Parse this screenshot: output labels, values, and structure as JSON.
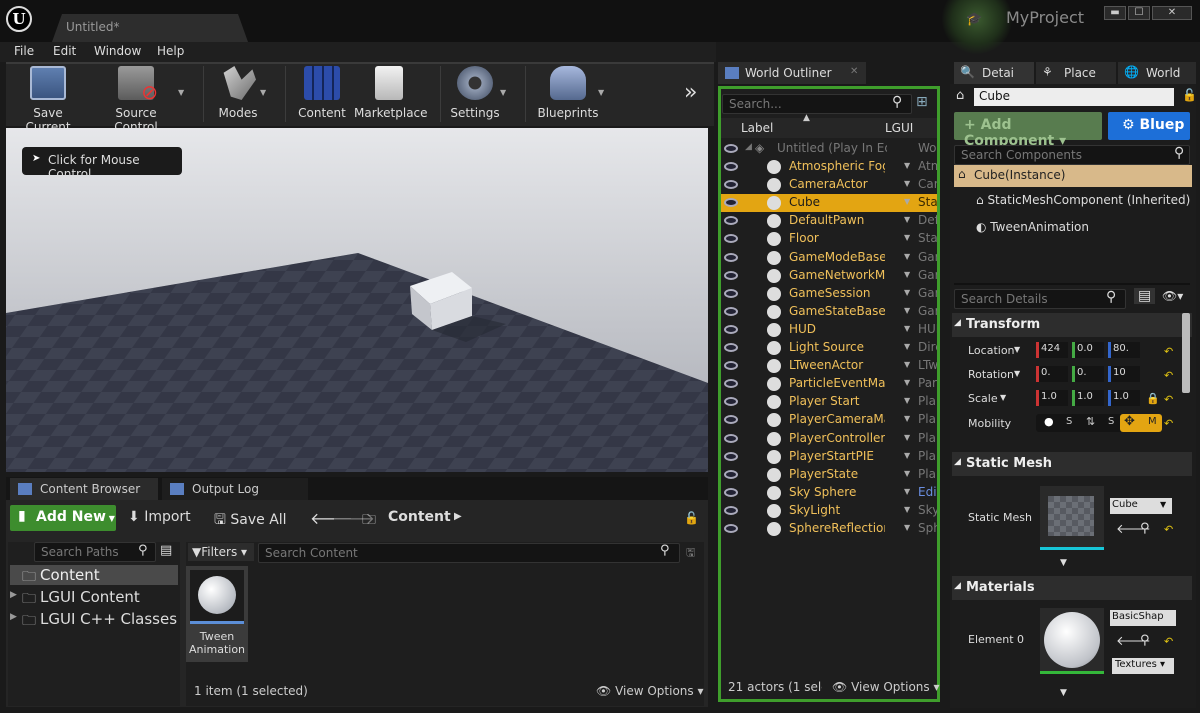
{
  "titlebar": {
    "doc_tab": "Untitled*",
    "project": "MyProject",
    "minimize": "▬",
    "restore": "☐",
    "close": "✕"
  },
  "menu": [
    "File",
    "Edit",
    "Window",
    "Help"
  ],
  "toolbar": {
    "save": "Save Current",
    "source": "Source Control",
    "modes": "Modes",
    "content": "Content",
    "marketplace": "Marketplace",
    "settings": "Settings",
    "blueprints": "Blueprints",
    "more": "»"
  },
  "viewport": {
    "hint": "Click for Mouse Control"
  },
  "content_browser": {
    "tab": "Content Browser",
    "tab2": "Output Log",
    "add_new": "Add New",
    "import": "Import",
    "save_all": "Save All",
    "path": "Content",
    "search_paths": "Search Paths",
    "filters": "Filters",
    "search_content": "Search Content",
    "tree": [
      "Content",
      "LGUI Content",
      "LGUI C++ Classes"
    ],
    "asset": {
      "line1": "Tween",
      "line2": "Animation"
    },
    "status": "1 item (1 selected)",
    "view_options": "View Options"
  },
  "outliner": {
    "tab": "World Outliner",
    "search": "Search...",
    "col_label": "Label",
    "col_lgui": "LGUI",
    "root": {
      "name": "Untitled (Play In Ed",
      "type": "Wor"
    },
    "rows": [
      {
        "name": "Atmospheric Fog",
        "type": "Atm"
      },
      {
        "name": "CameraActor",
        "type": "Car"
      },
      {
        "name": "Cube",
        "type": "Sta"
      },
      {
        "name": "DefaultPawn",
        "type": "Def"
      },
      {
        "name": "Floor",
        "type": "Sta"
      },
      {
        "name": "GameModeBase",
        "type": "Gar"
      },
      {
        "name": "GameNetworkMa",
        "type": "Gar"
      },
      {
        "name": "GameSession",
        "type": "Gar"
      },
      {
        "name": "GameStateBase",
        "type": "Gar"
      },
      {
        "name": "HUD",
        "type": "HUI"
      },
      {
        "name": "Light Source",
        "type": "Dire"
      },
      {
        "name": "LTweenActor",
        "type": "LTw"
      },
      {
        "name": "ParticleEventMa",
        "type": "Par"
      },
      {
        "name": "Player Start",
        "type": "Pla"
      },
      {
        "name": "PlayerCameraMa",
        "type": "Pla"
      },
      {
        "name": "PlayerController",
        "type": "Pla"
      },
      {
        "name": "PlayerStartPIE",
        "type": "Pla"
      },
      {
        "name": "PlayerState",
        "type": "Pla"
      },
      {
        "name": "Sky Sphere",
        "type": "Edi"
      },
      {
        "name": "SkyLight",
        "type": "Sky"
      },
      {
        "name": "SphereReflection",
        "type": "Sph"
      }
    ],
    "status": "21 actors (1 sele",
    "view_options": "View Options"
  },
  "details": {
    "tabs": [
      "Detai",
      "Place",
      "World"
    ],
    "name": "Cube",
    "add_component": "+ Add Component",
    "blueprint": "Bluep",
    "search_components": "Search Components",
    "instance": "Cube(Instance)",
    "comp1": "StaticMeshComponent (Inherited)",
    "comp2": "TweenAnimation",
    "search_details": "Search Details",
    "transform": "Transform",
    "location": "Location",
    "rotation": "Rotation",
    "scale": "Scale",
    "mobility": "Mobility",
    "loc": [
      "424",
      "0.0",
      "80."
    ],
    "rot": [
      "0.",
      "0.",
      "10"
    ],
    "scl": [
      "1.0",
      "1.0",
      "1.0"
    ],
    "mob": [
      "S",
      "S",
      "M"
    ],
    "static_mesh_section": "Static Mesh",
    "static_mesh_label": "Static Mesh",
    "static_mesh_value": "Cube",
    "materials": "Materials",
    "element0": "Element 0",
    "material_value": "BasicShap",
    "textures": "Textures"
  },
  "colors": {
    "accent_green": "#3f9e2c",
    "selection": "#e3a512",
    "row_text": "#f0c05a"
  }
}
